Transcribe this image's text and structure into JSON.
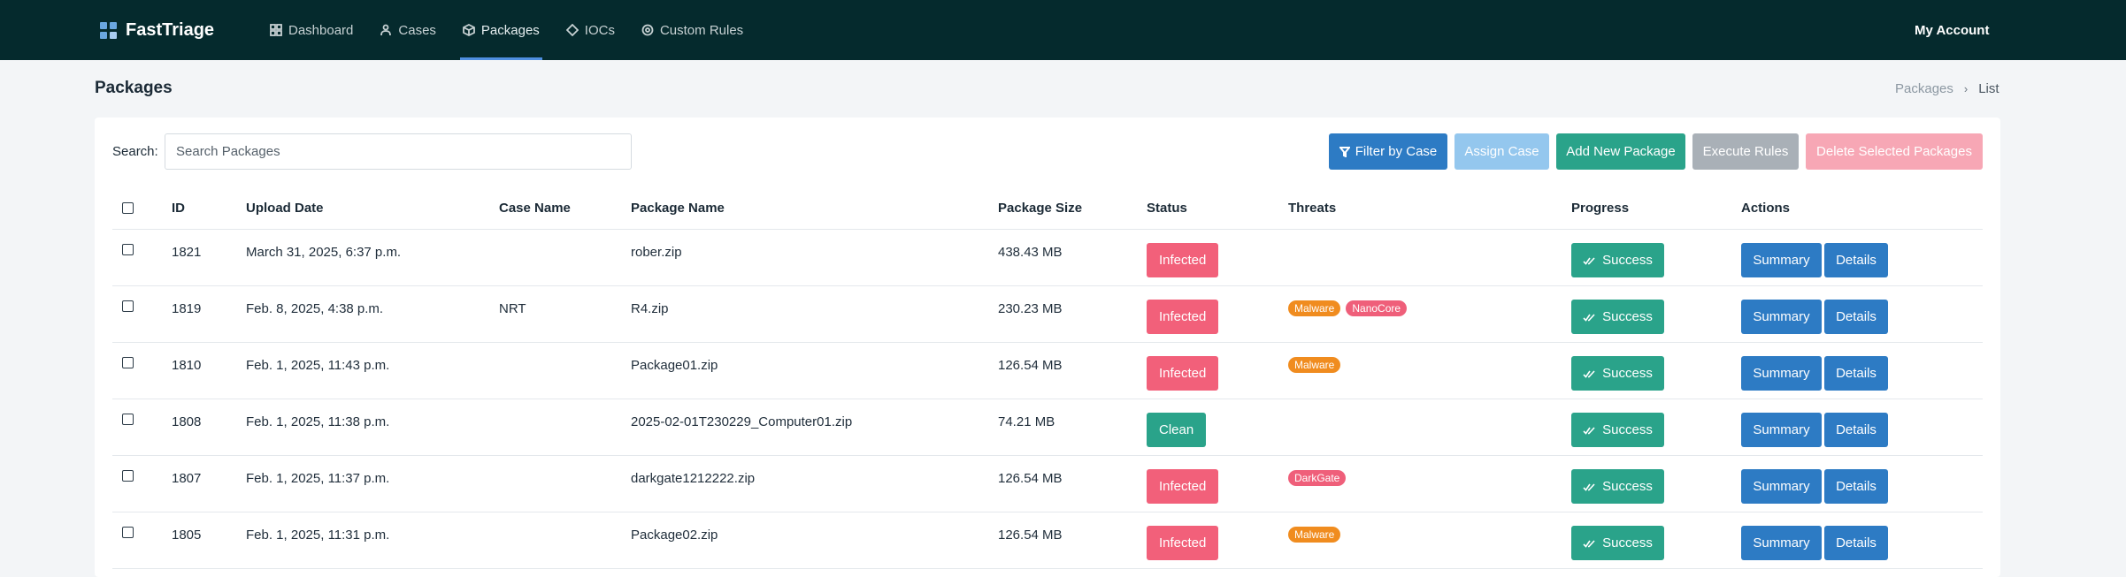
{
  "app": {
    "brand": "FastTriage",
    "account": "My Account",
    "nav": [
      {
        "label": "Dashboard",
        "icon": "dashboard-icon"
      },
      {
        "label": "Cases",
        "icon": "cases-icon"
      },
      {
        "label": "Packages",
        "icon": "package-icon",
        "active": true
      },
      {
        "label": "IOCs",
        "icon": "ioc-icon"
      },
      {
        "label": "Custom Rules",
        "icon": "rules-icon"
      }
    ]
  },
  "page": {
    "title": "Packages",
    "breadcrumb": [
      "Packages",
      "List"
    ]
  },
  "search": {
    "label": "Search:",
    "placeholder": "Search Packages",
    "value": ""
  },
  "toolbar": {
    "filter_label": "Filter by Case",
    "assign_label": "Assign Case",
    "add_label": "Add New Package",
    "execute_label": "Execute Rules",
    "delete_label": "Delete Selected Packages"
  },
  "table": {
    "headers": {
      "id": "ID",
      "upload_date": "Upload Date",
      "case_name": "Case Name",
      "package_name": "Package Name",
      "package_size": "Package Size",
      "status": "Status",
      "threats": "Threats",
      "progress": "Progress",
      "actions": "Actions"
    },
    "rows": [
      {
        "id": "1821",
        "upload_date": "March 31, 2025, 6:37 p.m.",
        "case_name": "",
        "package_name": "rober.zip",
        "package_size": "438.43 MB",
        "status": "Infected",
        "threats": [],
        "progress": "Success"
      },
      {
        "id": "1819",
        "upload_date": "Feb. 8, 2025, 4:38 p.m.",
        "case_name": "NRT",
        "package_name": "R4.zip",
        "package_size": "230.23 MB",
        "status": "Infected",
        "threats": [
          {
            "label": "Malware",
            "color": "#f08c1f"
          },
          {
            "label": "NanoCore",
            "color": "#ef5f7a"
          }
        ],
        "progress": "Success"
      },
      {
        "id": "1810",
        "upload_date": "Feb. 1, 2025, 11:43 p.m.",
        "case_name": "",
        "package_name": "Package01.zip",
        "package_size": "126.54 MB",
        "status": "Infected",
        "threats": [
          {
            "label": "Malware",
            "color": "#f08c1f"
          }
        ],
        "progress": "Success"
      },
      {
        "id": "1808",
        "upload_date": "Feb. 1, 2025, 11:38 p.m.",
        "case_name": "",
        "package_name": "2025-02-01T230229_Computer01.zip",
        "package_size": "74.21 MB",
        "status": "Clean",
        "threats": [],
        "progress": "Success"
      },
      {
        "id": "1807",
        "upload_date": "Feb. 1, 2025, 11:37 p.m.",
        "case_name": "",
        "package_name": "darkgate1212222.zip",
        "package_size": "126.54 MB",
        "status": "Infected",
        "threats": [
          {
            "label": "DarkGate",
            "color": "#ef5f7a"
          }
        ],
        "progress": "Success"
      },
      {
        "id": "1805",
        "upload_date": "Feb. 1, 2025, 11:31 p.m.",
        "case_name": "",
        "package_name": "Package02.zip",
        "package_size": "126.54 MB",
        "status": "Infected",
        "threats": [
          {
            "label": "Malware",
            "color": "#f08c1f"
          }
        ],
        "progress": "Success"
      }
    ],
    "action_summary": "Summary",
    "action_details": "Details"
  },
  "colors": {
    "navbar": "#052a2d",
    "primary": "#2d7bc4",
    "success": "#2aa38a",
    "danger": "#f2607a"
  }
}
